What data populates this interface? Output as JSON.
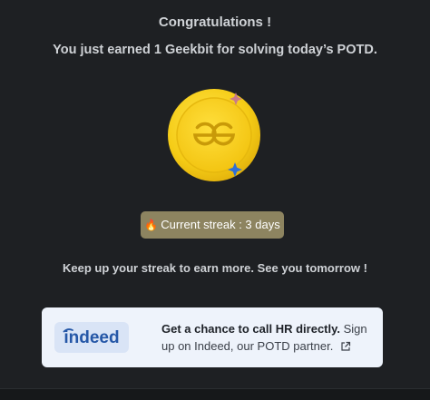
{
  "modal": {
    "title": "Congratulations !",
    "subtitle": "You just earned 1 Geekbit for solving today’s POTD.",
    "coin_icon": "geeksforgeeks-coin-icon",
    "streak": {
      "icon": "fire-icon",
      "label": "Current streak : 3 days"
    },
    "tagline": "Keep up your streak to earn more. See you tomorrow !"
  },
  "partner": {
    "logo_text": "indeed",
    "headline": "Get a chance to call HR directly.",
    "body": "Sign up on Indeed, our POTD partner.",
    "link_icon": "external-link-icon"
  },
  "colors": {
    "background": "#1e2023",
    "text": "#cfd2d6",
    "coin_gold": "#f7d21e",
    "streak_badge": "#8d8460",
    "card_bg": "#eef3fb",
    "indeed_blue": "#2557a7"
  }
}
